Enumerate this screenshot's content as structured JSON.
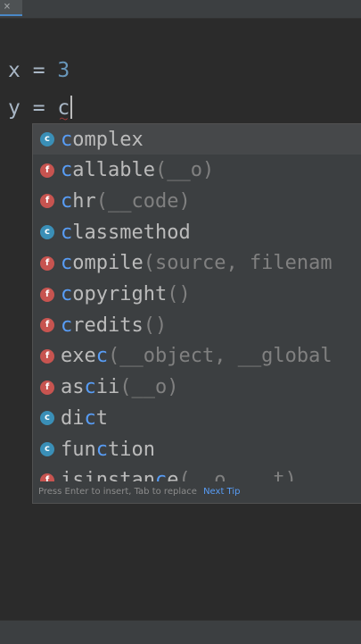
{
  "tab": {
    "close_glyph": "×"
  },
  "editor": {
    "line1": {
      "var": "x",
      "op": " = ",
      "value": "3"
    },
    "line2": {
      "var": "y",
      "op": " = ",
      "typed": "c"
    }
  },
  "completion": {
    "items": [
      {
        "kind": "c",
        "match": "c",
        "rest": "omplex",
        "params": ""
      },
      {
        "kind": "f",
        "match": "c",
        "rest": "allable",
        "params": "(__o)"
      },
      {
        "kind": "f",
        "match": "c",
        "rest": "hr",
        "params": "(__code)"
      },
      {
        "kind": "c",
        "match": "c",
        "rest": "lassmethod",
        "params": ""
      },
      {
        "kind": "f",
        "match": "c",
        "rest": "ompile",
        "params": "(source, filenam"
      },
      {
        "kind": "f",
        "match": "c",
        "rest": "opyright",
        "params": "()"
      },
      {
        "kind": "f",
        "match": "c",
        "rest": "redits",
        "params": "()"
      },
      {
        "kind": "f",
        "pre": "exe",
        "match": "c",
        "rest": "",
        "params": "(__object, __global"
      },
      {
        "kind": "f",
        "pre": "as",
        "match": "c",
        "rest": "ii",
        "params": "(__o)"
      },
      {
        "kind": "c",
        "pre": "di",
        "match": "c",
        "rest": "t",
        "params": ""
      },
      {
        "kind": "c",
        "pre": "fun",
        "match": "c",
        "rest": "tion",
        "params": ""
      },
      {
        "kind": "f",
        "pre": "isinstan",
        "match": "c",
        "rest": "e",
        "params": "(__o, __t)"
      }
    ],
    "footer": {
      "hint": "Press Enter to insert, Tab to replace",
      "tip_label": "Next Tip"
    }
  },
  "colors": {
    "background": "#2b2b2b",
    "popup": "#3c3f41",
    "match": "#589df6",
    "class_badge": "#3a8fb7",
    "function_badge": "#c75450"
  },
  "icons": {
    "class": "class-badge-icon",
    "function": "function-badge-icon"
  }
}
